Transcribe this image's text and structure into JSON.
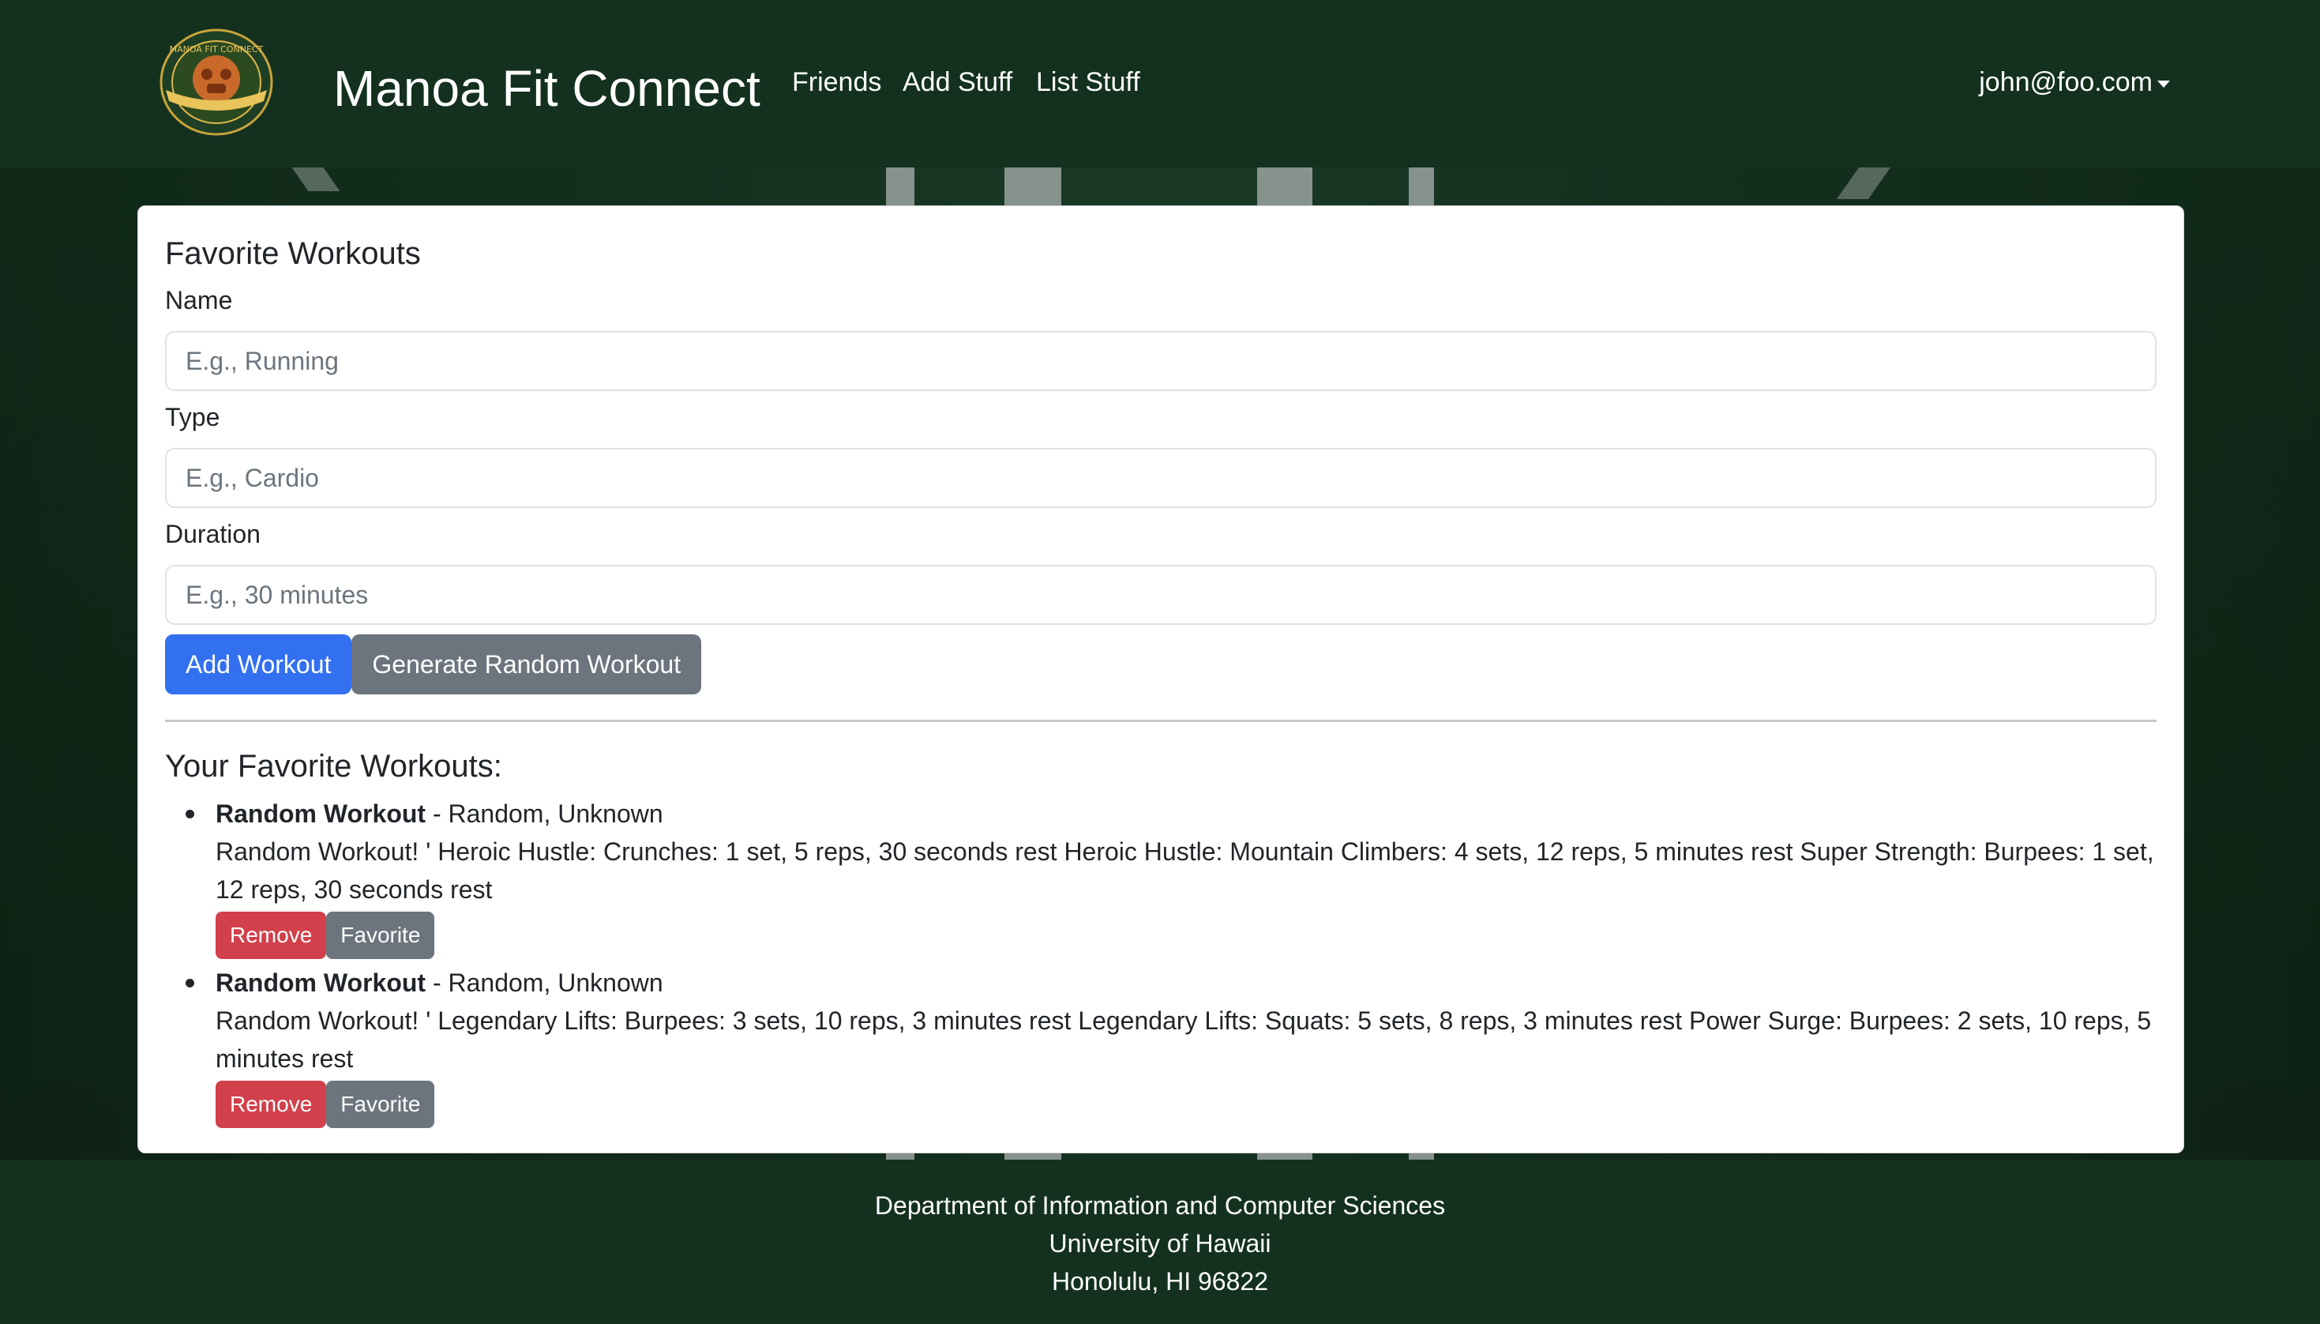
{
  "navbar": {
    "brand": "Manoa Fit Connect",
    "logo_icon": "manoa-fit-connect-logo",
    "links": [
      {
        "label": "Friends"
      },
      {
        "label": "Add Stuff"
      },
      {
        "label": "List Stuff"
      }
    ],
    "user": "john@foo.com"
  },
  "form": {
    "heading": "Favorite Workouts",
    "name_label": "Name",
    "name_placeholder": "E.g., Running",
    "type_label": "Type",
    "type_placeholder": "E.g., Cardio",
    "duration_label": "Duration",
    "duration_placeholder": "E.g., 30 minutes",
    "add_button": "Add Workout",
    "random_button": "Generate Random Workout"
  },
  "favorites": {
    "heading": "Your Favorite Workouts:",
    "items": [
      {
        "title": "Random Workout",
        "meta": " - Random, Unknown",
        "description": "Random Workout! ' Heroic Hustle: Crunches: 1 set, 5 reps, 30 seconds rest Heroic Hustle: Mountain Climbers: 4 sets, 12 reps, 5 minutes rest Super Strength: Burpees: 1 set, 12 reps, 30 seconds rest",
        "remove_label": "Remove",
        "favorite_label": "Favorite"
      },
      {
        "title": "Random Workout",
        "meta": " - Random, Unknown",
        "description": "Random Workout! ' Legendary Lifts: Burpees: 3 sets, 10 reps, 3 minutes rest Legendary Lifts: Squats: 5 sets, 8 reps, 3 minutes rest Power Surge: Burpees: 2 sets, 10 reps, 5 minutes rest",
        "remove_label": "Remove",
        "favorite_label": "Favorite"
      }
    ]
  },
  "footer": {
    "line1": "Department of Information and Computer Sciences",
    "line2": "University of Hawaii",
    "line3": "Honolulu, HI 96822"
  },
  "colors": {
    "navbar_bg": "#143120",
    "primary": "#3270f0",
    "secondary": "#6c757d",
    "danger": "#d1404b"
  }
}
